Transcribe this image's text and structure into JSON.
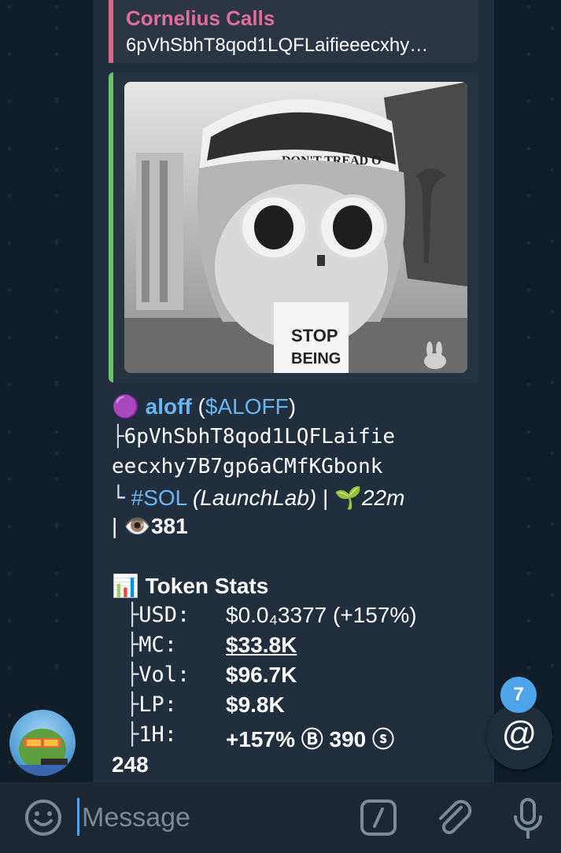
{
  "reply": {
    "author": "Cornelius Calls",
    "text": "6pVhSbhT8qod1LQFLaifieeecxhy…"
  },
  "media": {
    "cap_text": "DON'T TREAD O",
    "shirt_line1": "STOP",
    "shirt_line2": "BEING"
  },
  "token": {
    "emoji": "🟣",
    "name": "aloff",
    "ticker_open": "(",
    "ticker": "$ALOFF",
    "ticker_close": ")",
    "branch1": "├",
    "address_line1": "6pVhSbhT8qod1LQFLaifie",
    "address_line2": "eecxhy7B7gp6aCMfKGbonk",
    "branch2": "└",
    "chain_tag": "#SOL",
    "platform": "(LaunchLab)",
    "sep": "|",
    "age_emoji": "🌱",
    "age": "22m",
    "views_sep": "|",
    "views_emoji": "👁️",
    "views": "381"
  },
  "stats": {
    "header_emoji": "📊",
    "header": "Token Stats",
    "rows": [
      {
        "branch": "├",
        "key": "USD:",
        "value": "$0.0₄3377 (+157%)"
      },
      {
        "branch": "├",
        "key": "MC:",
        "value": "$33.8K"
      },
      {
        "branch": "├",
        "key": "Vol:",
        "value": "$96.7K"
      },
      {
        "branch": "├",
        "key": "LP:",
        "value": "$9.8K"
      },
      {
        "branch": "├",
        "key": "1H:",
        "value": "+157% Ⓑ 390 ⓢ"
      }
    ],
    "overflow_value": "248"
  },
  "mention_badge": "7",
  "mention_symbol": "@",
  "input": {
    "placeholder": "Message"
  },
  "colors": {
    "accent": "#4ea4e8",
    "link": "#68b6f3",
    "reply_author": "#e26e98",
    "reply_bar": "#d46a8d",
    "media_bar": "#6ac36b"
  }
}
